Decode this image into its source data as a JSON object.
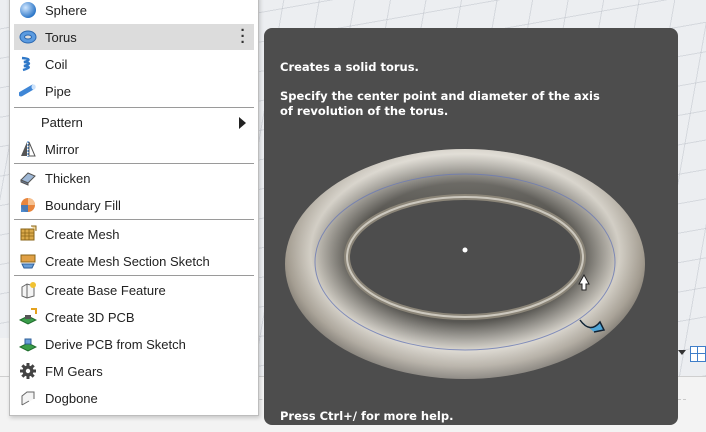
{
  "menu": {
    "items": [
      {
        "label": "Sphere",
        "icon": "sphere-icon"
      },
      {
        "label": "Torus",
        "icon": "torus-icon",
        "highlighted": true
      },
      {
        "label": "Coil",
        "icon": "coil-icon"
      },
      {
        "label": "Pipe",
        "icon": "pipe-icon"
      },
      {
        "label": "Pattern",
        "icon": "none",
        "submenu": true
      },
      {
        "label": "Mirror",
        "icon": "mirror-icon"
      },
      {
        "label": "Thicken",
        "icon": "thicken-icon"
      },
      {
        "label": "Boundary Fill",
        "icon": "boundary-fill-icon"
      },
      {
        "label": "Create Mesh",
        "icon": "create-mesh-icon"
      },
      {
        "label": "Create Mesh Section Sketch",
        "icon": "mesh-section-sketch-icon"
      },
      {
        "label": "Create Base Feature",
        "icon": "base-feature-icon"
      },
      {
        "label": "Create 3D PCB",
        "icon": "pcb-3d-icon"
      },
      {
        "label": "Derive PCB from Sketch",
        "icon": "derive-pcb-icon"
      },
      {
        "label": "FM Gears",
        "icon": "gear-icon"
      },
      {
        "label": "Dogbone",
        "icon": "dogbone-icon"
      }
    ]
  },
  "tooltip": {
    "title": "Creates a solid torus.",
    "description": "Specify the center point and diameter of the axis of revolution of the torus.",
    "footer": "Press Ctrl+/ for more help."
  },
  "colors": {
    "tooltip_bg": "#4d4d4d",
    "highlight_bg": "#dcdcdc",
    "accent_blue": "#3f7ec9"
  }
}
